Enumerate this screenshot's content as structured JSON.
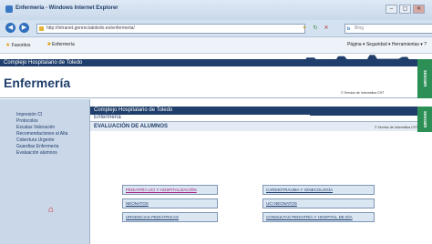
{
  "window": {
    "title": "Enfermería - Windows Internet Explorer",
    "buttons": {
      "minimize": "–",
      "restore": "▢",
      "close": "✕"
    }
  },
  "navbar": {
    "back_icon": "back-arrow-icon",
    "forward_icon": "forward-arrow-icon",
    "address": "http://intranet.gerenciatoledo.es/enfermeria/",
    "search_placeholder": "Bing",
    "search_brand": "b"
  },
  "favbar": {
    "favorites": "Favoritos",
    "tab": "Enfermería",
    "commands": "Página ▾  Seguridad ▾  Herramientas ▾  ?"
  },
  "header": {
    "org": "Complejo Hospitalario de Toledo",
    "title": "Enfermería",
    "note": "© Servicio de Informática CHT",
    "logo": "sescam"
  },
  "sidebar": {
    "items": [
      {
        "label": "Impresión CI"
      },
      {
        "label": "Protocolos"
      },
      {
        "label": "Escalas Valoración"
      },
      {
        "label": "Recomendaciones al Alta"
      },
      {
        "label": "Cobertura Urgente"
      },
      {
        "label": "Guardias Enfermería"
      },
      {
        "label": "Evaluación alumnos"
      }
    ],
    "home_icon": "home-icon"
  },
  "inner": {
    "org": "Complejo Hospitalario de Toledo",
    "subtitle": "Enfermería",
    "section": "EVALUACIÓN DE ALUMNOS",
    "note": "© Servicio de Informática CHT",
    "logo": "sescam"
  },
  "menu": {
    "left": [
      {
        "label": "PEDIATRÍA UCI Y HOSPITALIZACIÓN",
        "active": true
      },
      {
        "label": "NEONATOS",
        "active": false
      },
      {
        "label": "URGENCIAS PEDIÁTRICAS",
        "active": false
      }
    ],
    "right": [
      {
        "label": "CARDIOTRAUMA Y GINECOLOGÍA",
        "active": false
      },
      {
        "label": "UCI NEONATOS",
        "active": false
      },
      {
        "label": "CONSULTAS PEDIATRÍA Y HOSPITAL DE DÍA",
        "active": false
      }
    ]
  },
  "colors": {
    "navy": "#1f3e6b",
    "sidebar": "#cad7e8",
    "logo_green": "#2c8f55",
    "active_link": "#a0207e"
  }
}
